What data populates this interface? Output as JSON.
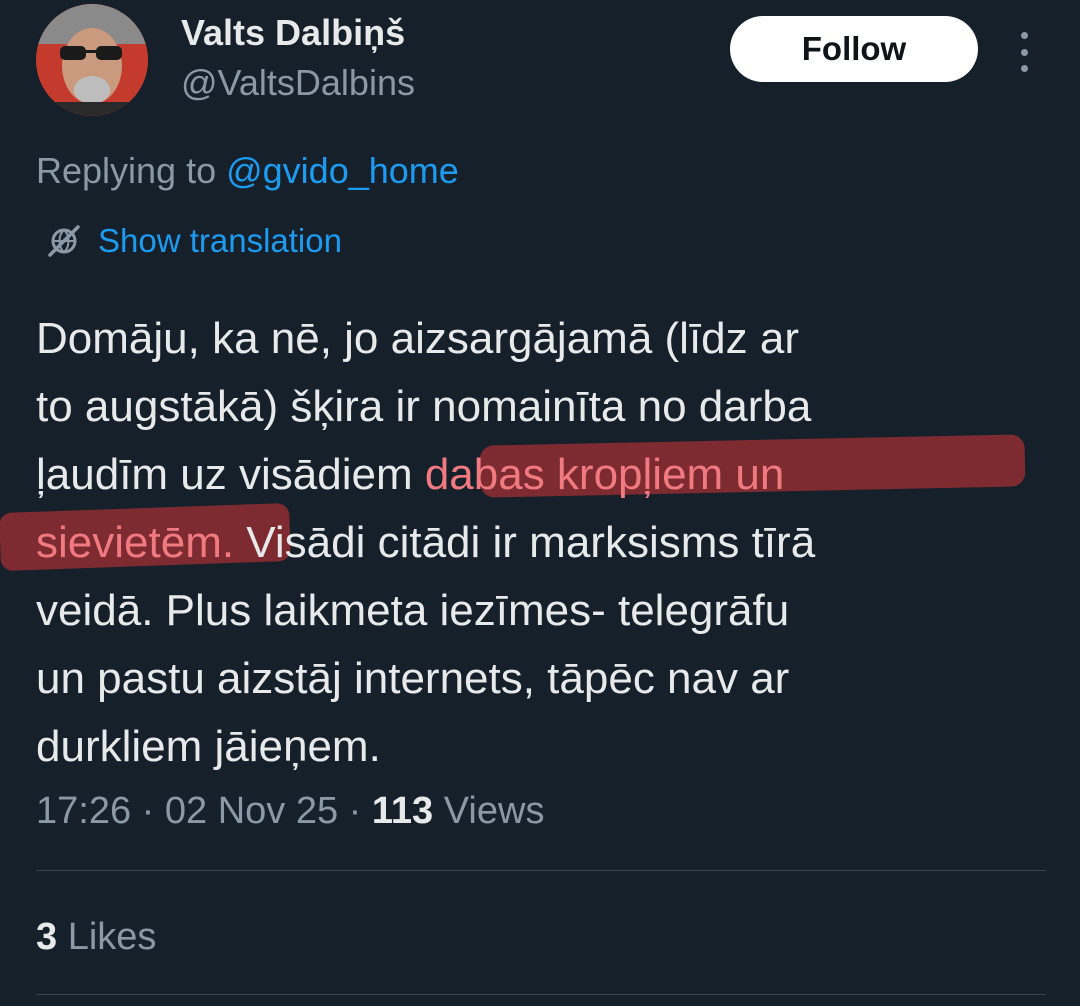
{
  "author": {
    "display_name": "Valts Dalbiņš",
    "handle": "@ValtsDalbins"
  },
  "follow_label": "Follow",
  "reply": {
    "prefix": "Replying to ",
    "mention": "@gvido_home"
  },
  "translate": {
    "label": "Show translation"
  },
  "tweet": {
    "line1": "Domāju, ka nē, jo aizsargājamā (līdz ar",
    "line2": "to augstākā) šķira ir nomainīta no darba",
    "line3_pre": "ļaudīm uz visādiem ",
    "line3_hl": "dabas kropļiem un",
    "line4_hl": "sievietēm.",
    "line4_post": " Visādi citādi ir marksisms tīrā",
    "line5": "veidā. Plus laikmeta iezīmes- telegrāfu",
    "line6": "un pastu aizstāj internets, tāpēc nav ar",
    "line7": "durkliem jāieņem."
  },
  "meta": {
    "time": "17:26",
    "sep1": " · ",
    "date": "02 Nov 25",
    "sep2": " · ",
    "views_count": "113",
    "views_label": " Views"
  },
  "likes": {
    "count": "3",
    "label": " Likes"
  },
  "colors": {
    "background": "#15202b",
    "accent": "#1d9bf0",
    "highlight": "#7d2a31",
    "highlight_text": "#f07a80",
    "secondary_text": "#8b98a5"
  },
  "icons": {
    "more": "vertical-ellipsis-icon",
    "translate": "globe-slash-icon"
  }
}
